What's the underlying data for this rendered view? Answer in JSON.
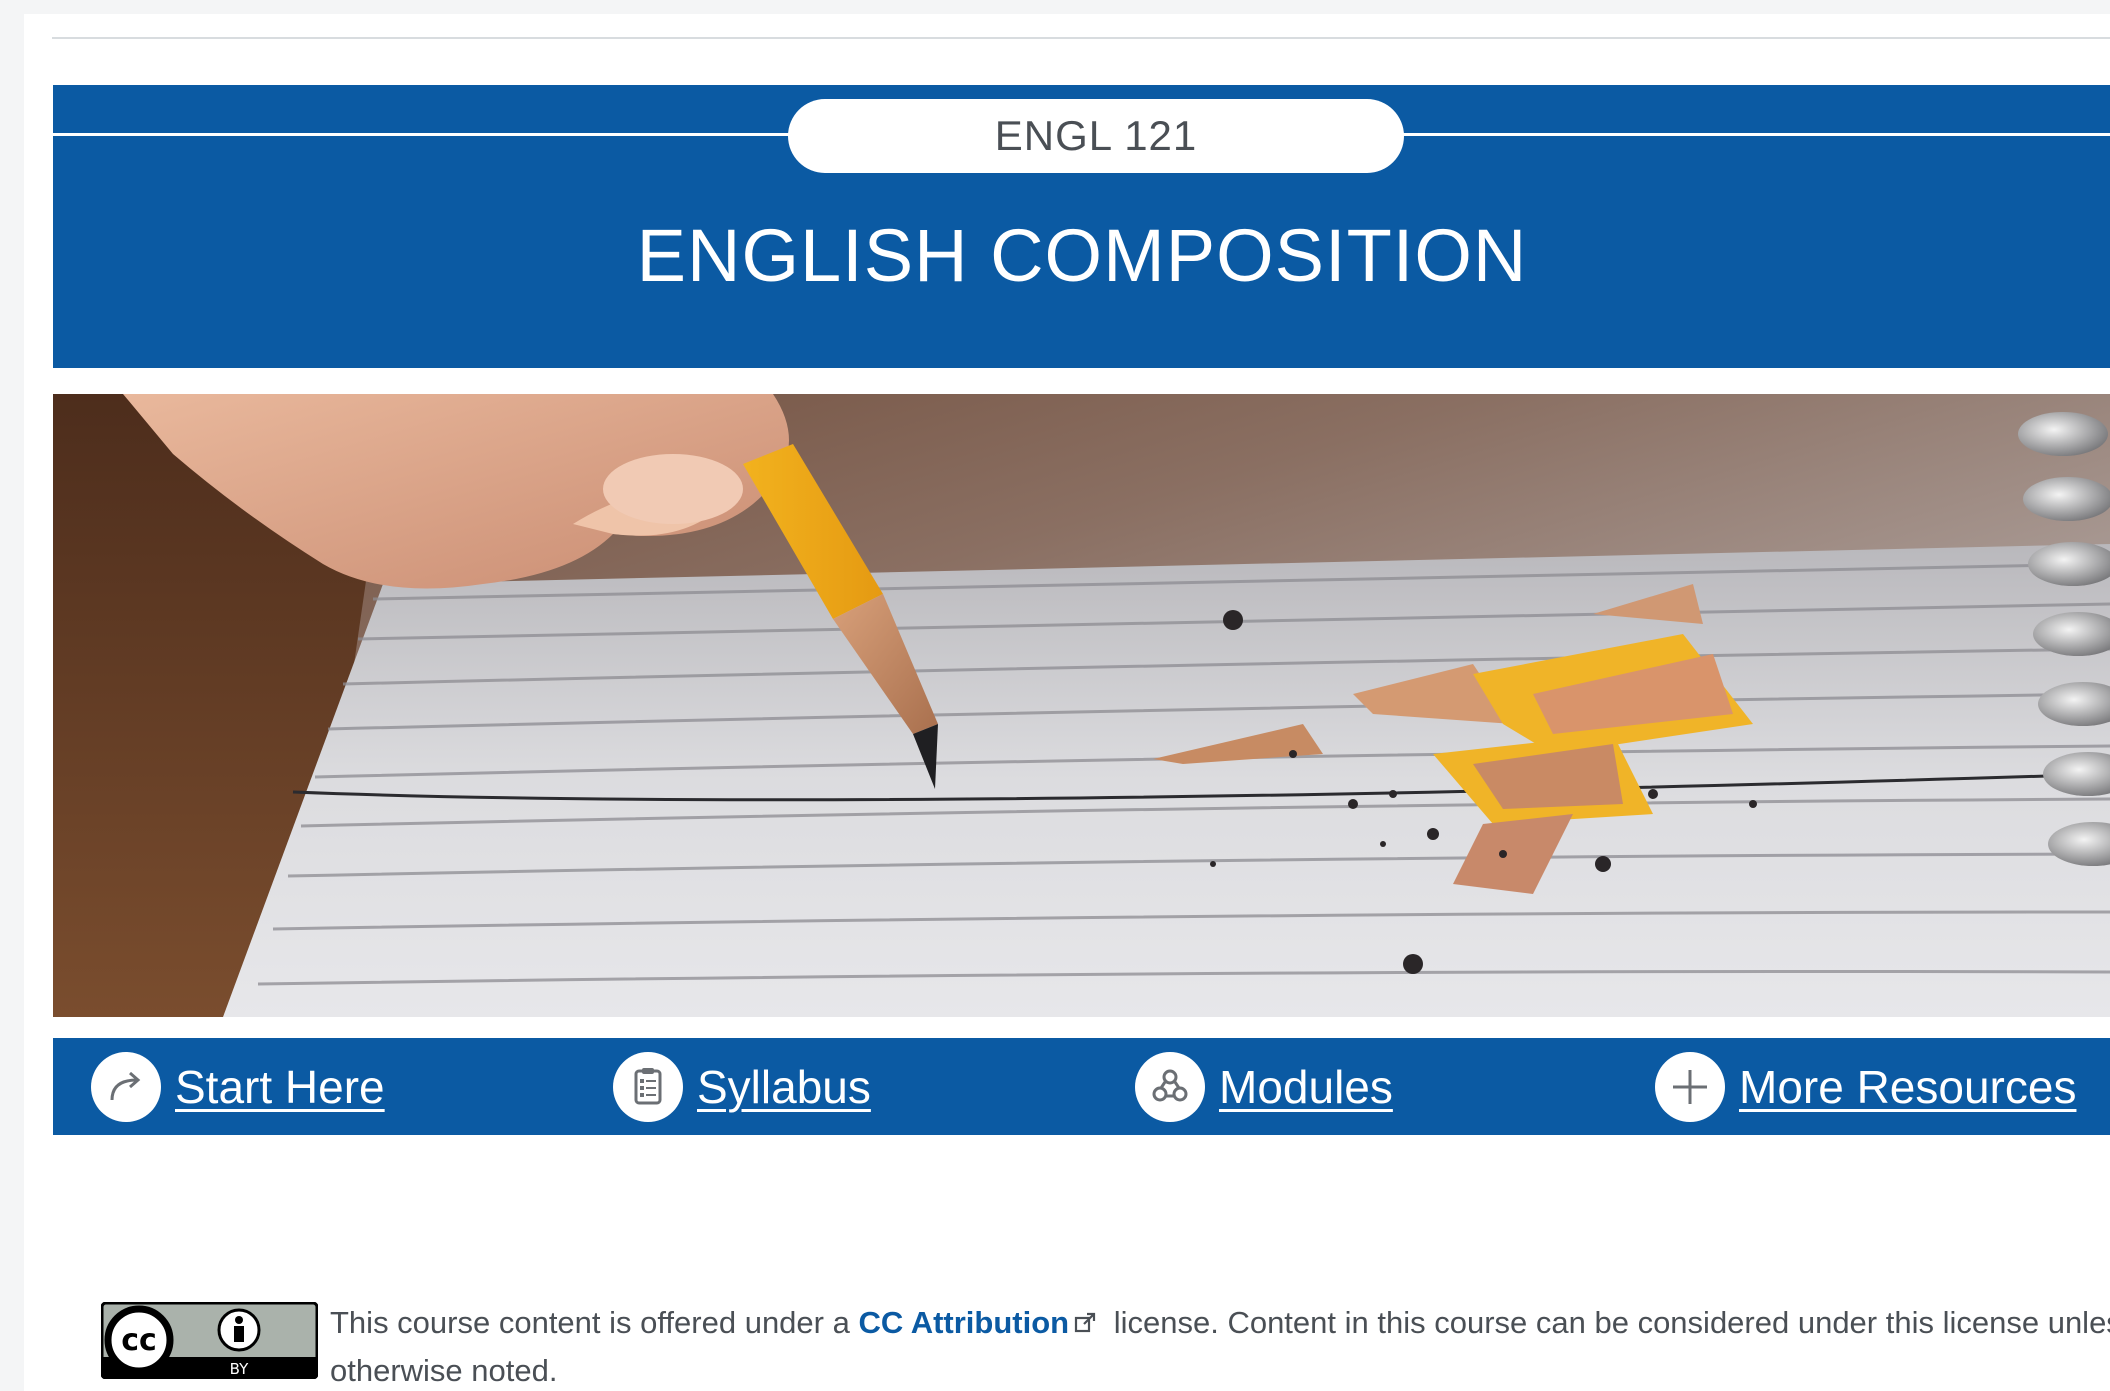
{
  "header": {
    "course_code": "ENGL 121",
    "course_title": "ENGLISH COMPOSITION"
  },
  "hero": {
    "icon": "pencil-writing-photo"
  },
  "nav": {
    "items": [
      {
        "label": "Start Here",
        "icon": "arrow-forward-icon"
      },
      {
        "label": "Syllabus",
        "icon": "clipboard-icon"
      },
      {
        "label": "Modules",
        "icon": "modules-icon"
      },
      {
        "label": "More Resources",
        "icon": "plus-icon"
      }
    ]
  },
  "footer": {
    "badge_cc": "cc",
    "badge_by": "BY",
    "license_prefix": "This course content is offered under a ",
    "license_link": "CC Attribution",
    "license_suffix": "license. Content in this course can be considered under this license unless",
    "license_line2": "otherwise noted."
  },
  "colors": {
    "banner_blue": "#0b5aa3",
    "text_gray": "#4a4f55"
  }
}
